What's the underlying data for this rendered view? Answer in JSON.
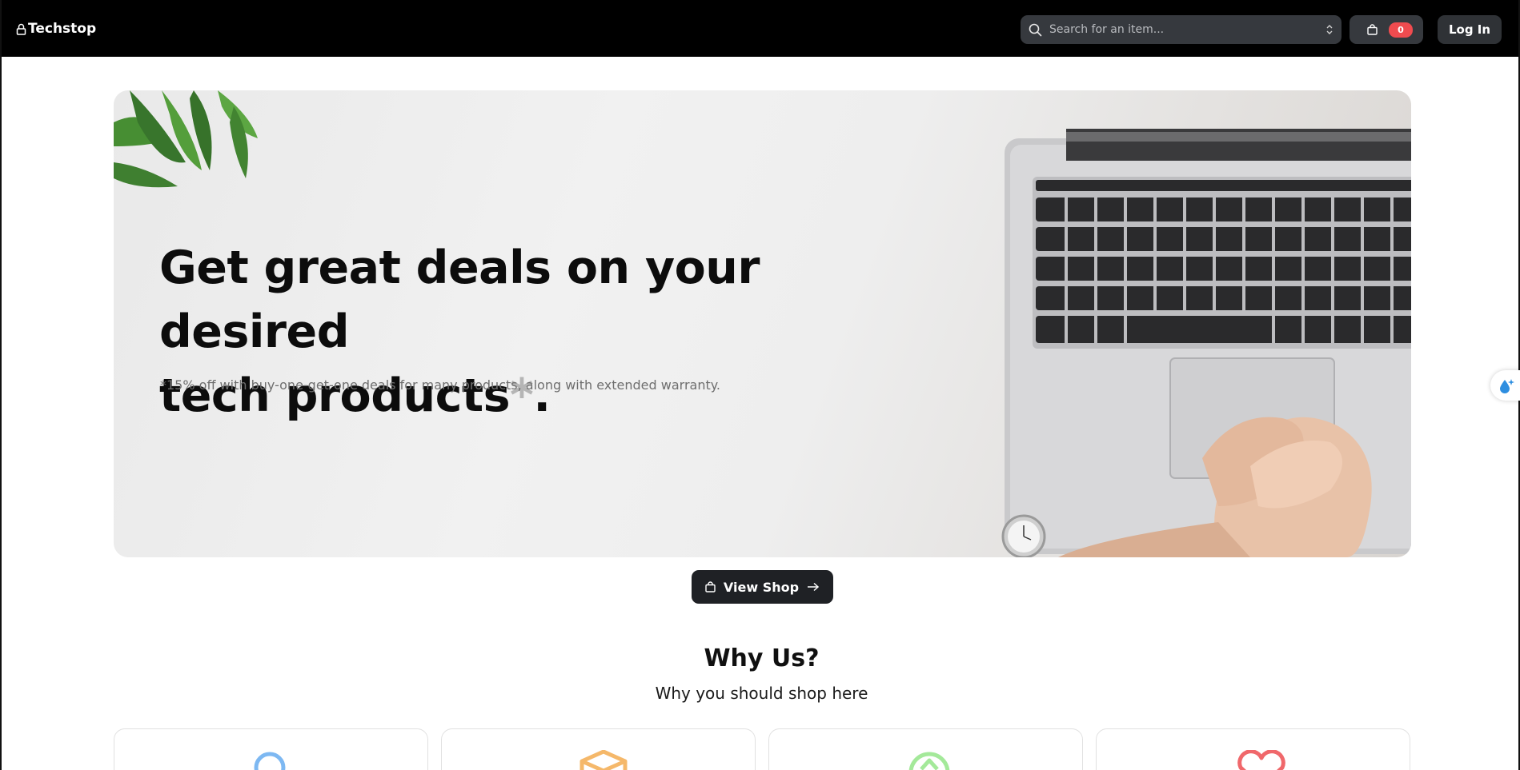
{
  "header": {
    "brand": "Techstop",
    "search_placeholder": "Search for an item...",
    "cart_count": "0",
    "login_label": "Log In"
  },
  "hero": {
    "title_line1": "Get great deals on your desired",
    "title_line2": "tech products",
    "title_asterisk": "*",
    "title_end": ".",
    "subtitle": "*15% off with buy-one-get-one deals for many products, along with extended warranty."
  },
  "cta": {
    "label": "View Shop"
  },
  "why": {
    "title": "Why Us?",
    "subtitle": "Why you should shop here",
    "cards": [
      {
        "icon": "search-icon",
        "color": "#7db8f2"
      },
      {
        "icon": "box-icon",
        "color": "#f5b86a"
      },
      {
        "icon": "upload-icon",
        "color": "#a4e99a"
      },
      {
        "icon": "heart-icon",
        "color": "#f0686b"
      }
    ]
  },
  "colors": {
    "header_bg": "#000000",
    "badge": "#f04b4f",
    "cta_bg": "#1f2125"
  }
}
